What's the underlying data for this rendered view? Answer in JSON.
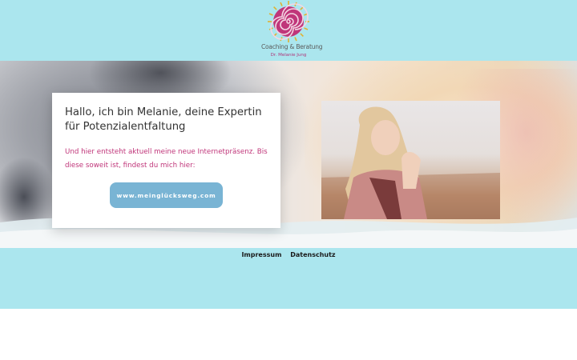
{
  "header": {
    "logo": {
      "title": "Coaching & Beratung",
      "subtitle": "Dr. Melanie Jung",
      "icon": "spiral-sun-icon",
      "colors": {
        "spiral": "#c0367a",
        "rays": "#e0b232"
      }
    }
  },
  "card": {
    "heading": "Hallo, ich bin Melanie, deine Expertin für Potenzialentfaltung",
    "text": "Und hier entsteht aktuell meine neue Internetpräsenz. Bis diese soweit ist, findest du mich hier:",
    "button_label": "www.meinglücksweg.com"
  },
  "footer": {
    "links": [
      "Impressum",
      "Datenschutz"
    ]
  },
  "colors": {
    "teal_band": "#abe6ee",
    "accent_pink": "#c0367a",
    "button_blue": "#79b4d4"
  }
}
